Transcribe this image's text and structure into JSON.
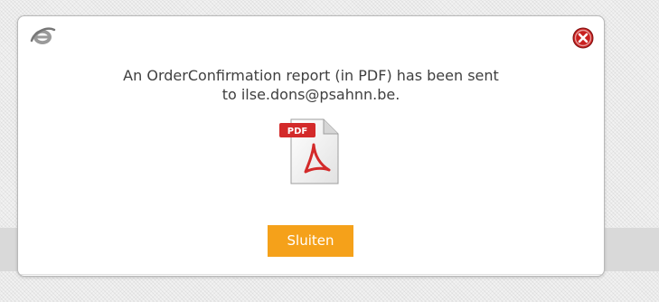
{
  "dialog": {
    "message_line1": "An OrderConfirmation report (in PDF) has been sent",
    "message_line2": "to ilse.dons@psahnn.be.",
    "file_label": "PDF",
    "close_button_label": "Sluiten",
    "icons": {
      "browser": "browser-icon",
      "close": "close-icon",
      "pdf": "pdf-file-icon"
    },
    "colors": {
      "accent": "#f5a11a",
      "close_icon": "#c9201f",
      "pdf_badge": "#d32a2a",
      "text": "#3f3f3f"
    }
  }
}
